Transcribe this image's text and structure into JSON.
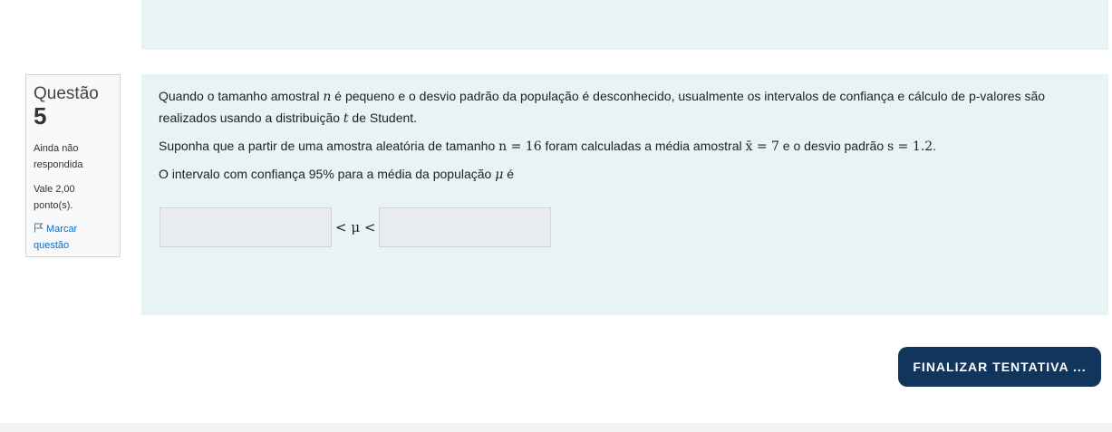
{
  "question": {
    "label": "Questão",
    "number": "5",
    "state": "Ainda não respondida",
    "grade": "Vale 2,00 ponto(s).",
    "flag_label": "Marcar questão"
  },
  "content": {
    "p1_a": "Quando o tamanho amostral ",
    "p1_n": "n",
    "p1_b": " é pequeno e o desvio padrão da população é desconhecido, usualmente os intervalos de confiança e cálculo de p-valores são realizados usando a distribuição ",
    "p1_t": "t",
    "p1_c": " de Student.",
    "p2_a": "Suponha que a partir de uma amostra aleatória de tamanho ",
    "p2_n_eq": "n = 16",
    "p2_b": " foram calculadas a média amostral ",
    "p2_x_eq": "x̄ = 7",
    "p2_c": " e o desvio padrão ",
    "p2_s_eq": "s = 1.2",
    "p2_d": ".",
    "p3_a": "O intervalo com confiança 95% para a média da população ",
    "p3_mu": "μ",
    "p3_b": " é"
  },
  "answer": {
    "lower_value": "",
    "upper_value": "",
    "inequality": "< μ <"
  },
  "finish_button": "FINALIZAR TENTATIVA ...",
  "colors": {
    "content_bg": "#e7f3f5",
    "button_bg": "#12355b",
    "link": "#0f6cbf"
  },
  "icons": {
    "flag": "flag-icon"
  }
}
